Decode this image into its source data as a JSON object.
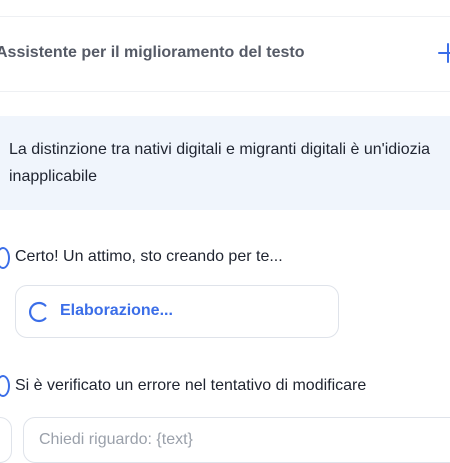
{
  "header": {
    "title": "Assistente per il miglioramento del testo",
    "add_icon": "plus-icon"
  },
  "prompt": {
    "text": "La distinzione tra nativi digitali e migranti digitali è un'idiozia inapplicabile"
  },
  "messages": [
    {
      "text": "Certo! Un attimo, sto creando per te..."
    },
    {
      "text": "Si è verificato un errore nel tentativo di modificare"
    }
  ],
  "status": {
    "label": "Elaborazione...",
    "icon": "spinner-icon"
  },
  "input": {
    "placeholder": "Chiedi riguardo: {text}"
  },
  "colors": {
    "accent": "#3b6ee8",
    "prompt_bg": "#f0f5fc",
    "border": "#dfe3ea"
  }
}
